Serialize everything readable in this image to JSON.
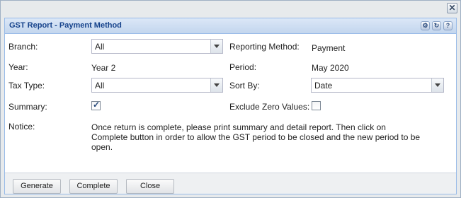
{
  "window": {
    "close_glyph": "✕"
  },
  "panel": {
    "title": "GST Report - Payment Method",
    "tools": [
      "gear-icon",
      "refresh-icon",
      "help-icon"
    ]
  },
  "form": {
    "branch": {
      "label": "Branch:",
      "value": "All"
    },
    "reporting_method": {
      "label": "Reporting Method:",
      "value": "Payment"
    },
    "year": {
      "label": "Year:",
      "value": "Year 2"
    },
    "period": {
      "label": "Period:",
      "value": "May 2020"
    },
    "tax_type": {
      "label": "Tax Type:",
      "value": "All"
    },
    "sort_by": {
      "label": "Sort By:",
      "value": "Date"
    },
    "summary": {
      "label": "Summary:",
      "checked": true
    },
    "exclude_zero": {
      "label": "Exclude Zero Values:",
      "checked": false
    },
    "notice": {
      "label": "Notice:",
      "text": "Once return is complete, please print summary and detail report. Then click on Complete button in order to allow the GST period to be closed and the new period to be open."
    }
  },
  "buttons": {
    "generate": "Generate",
    "complete": "Complete",
    "close": "Close"
  },
  "colors": {
    "header_text": "#15428b",
    "panel_border": "#99bbe8"
  }
}
